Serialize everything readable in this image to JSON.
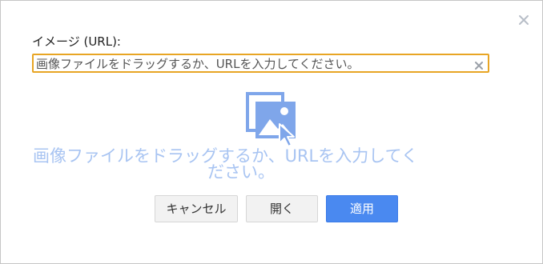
{
  "dialog": {
    "close_icon": "close-icon",
    "url_field": {
      "label": "イメージ (URL):",
      "placeholder": "画像ファイルをドラッグするか、URLを入力してください。",
      "value": "",
      "clear_icon": "clear-icon"
    },
    "drop_zone": {
      "icon": "image-drop-icon",
      "text_line1": "画像ファイルをドラッグするか、URLを入力してく",
      "text_line2": "ださい。"
    },
    "buttons": {
      "cancel_label": "キャンセル",
      "open_label": "開く",
      "apply_label": "適用"
    }
  },
  "colors": {
    "accent": "#4a89f0",
    "focus_border": "#e8a524",
    "drop_text": "#a8c4f2",
    "drop_icon": "#7fa6ea"
  }
}
